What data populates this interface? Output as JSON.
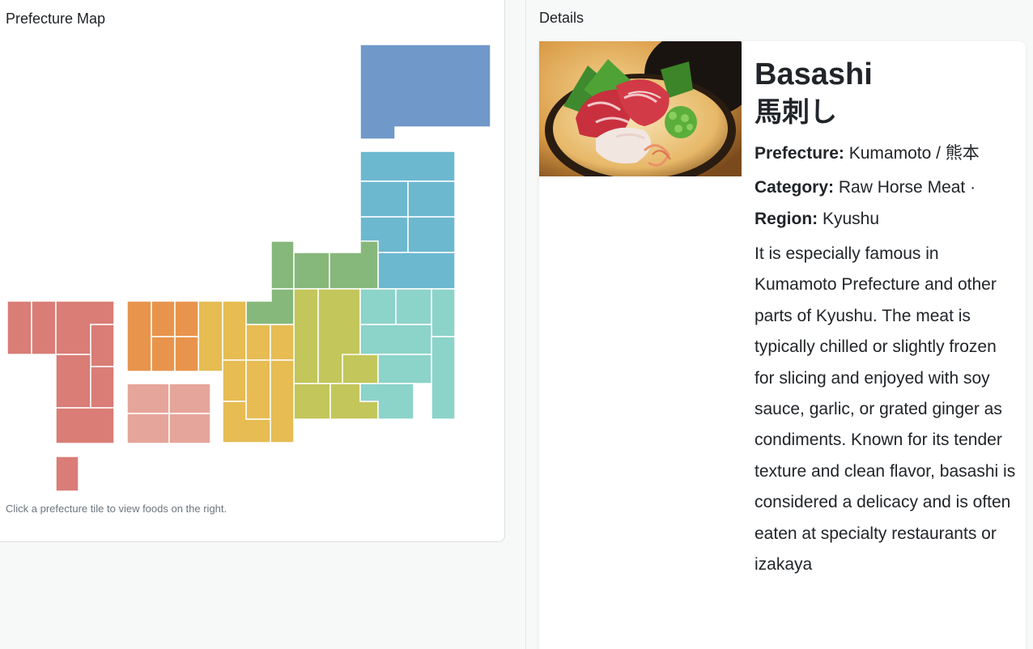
{
  "map_panel": {
    "title": "Prefecture Map",
    "hint": "Click a prefecture tile to view foods on the right."
  },
  "details_panel": {
    "title": "Details",
    "food": {
      "name": "Basashi",
      "name_jp": "馬刺し",
      "prefecture_label": "Prefecture:",
      "prefecture_value": "Kumamoto / 熊本",
      "category_label": "Category:",
      "category_value": "Raw Horse Meat ·",
      "region_label": "Region:",
      "region_value": "Kyushu",
      "description": "It is especially famous in Kumamoto Prefecture and other parts of Kyushu. The meat is typically chilled or slightly frozen for slicing and enjoyed with soy sauce, garlic, or grated ginger as condiments. Known for its tender texture and clean flavor, basashi is considered a delicacy and is often eaten at specialty restaurants or izakaya"
    }
  },
  "colors": {
    "hokkaido": "#7098c8",
    "tohoku": "#6cb8cf",
    "kanto": "#8cd3c9",
    "chubu": "#c3c65a",
    "hokuriku": "#87b87b",
    "kansai": "#e6bc53",
    "chugoku": "#e8944c",
    "shikoku": "#e6a59b",
    "kyushu": "#d97d76"
  },
  "icons": {
    "food_photo": "basashi-photo"
  }
}
